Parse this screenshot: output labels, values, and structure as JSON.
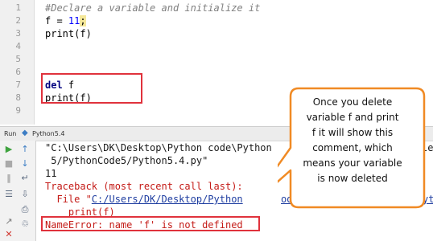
{
  "editor": {
    "line_numbers": [
      "1",
      "2",
      "3",
      "4",
      "5",
      "6",
      "7",
      "8",
      "9"
    ],
    "line1_comment": "#Declare a variable and initialize it",
    "line2_var": "f = ",
    "line2_num": "11",
    "line2_semi": ";",
    "line3": "print(f)",
    "line7_kw": "del",
    "line7_rest": " f",
    "line8": "print(f)"
  },
  "run_panel": {
    "run_label": "Run",
    "tab_label": "Python5.4"
  },
  "console": {
    "line1": "\"C:\\Users\\DK\\Desktop\\Python code\\Python",
    "line1_tail": "le",
    "line2": " 5/PythonCode5/Python5.4.py\"",
    "line3": "11",
    "line4": "Traceback (most recent call last):",
    "line5_prefix": "  File \"",
    "line5_path": "C:/Users/DK/Desktop/Python",
    "line5_path2": "ode/",
    "line5_tail": "yt",
    "line6": "    print(f)",
    "line7": "NameError: name 'f' is not defined"
  },
  "callout": {
    "lines": [
      "Once you delete",
      "variable f and print",
      "f it will show this",
      "comment, which",
      "means your variable",
      "is now deleted"
    ]
  },
  "colors": {
    "highlight_box": "#e0323c",
    "callout_fill": "#ffffff",
    "callout_border": "#f08a24",
    "error_text": "#c41a16",
    "path_link": "#1f3ea1"
  }
}
